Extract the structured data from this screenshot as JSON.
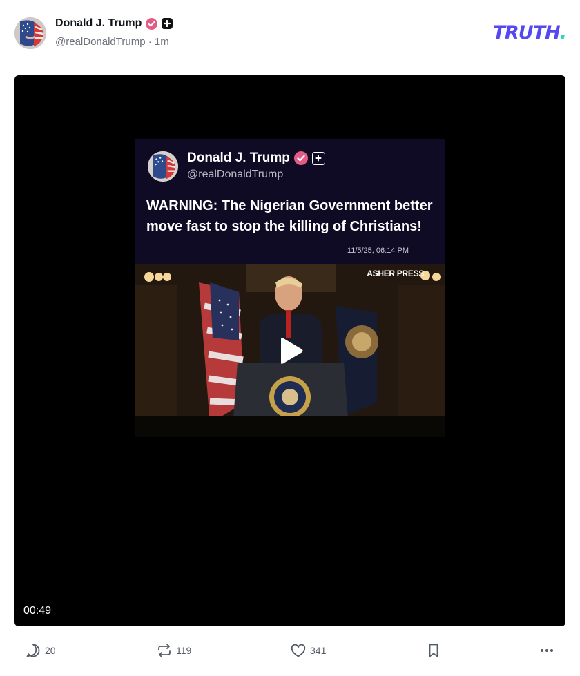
{
  "post": {
    "author": {
      "display_name": "Donald J. Trump",
      "handle": "@realDonaldTrump",
      "separator": "·",
      "timestamp": "1m",
      "avatar_icon": "flag-portrait-avatar",
      "verified_icon": "verified-check-icon",
      "plus_icon": "plus-badge-icon",
      "verified_color": "#e35c86"
    },
    "brand": {
      "logo_text": "TRUTH",
      "logo_dot": ".",
      "logo_color": "#5448ee",
      "dot_color": "#30d5c8"
    },
    "media": {
      "inner_post": {
        "display_name": "Donald J. Trump",
        "handle": "@realDonaldTrump",
        "text": "WARNING: The Nigerian Government better move fast to stop the killing of Christians!",
        "timestamp": "11/5/25, 06:14 PM",
        "background": "#0f0b24"
      },
      "watermark": "ASHER PRESS",
      "duration": "00:49",
      "play_icon": "play-icon"
    },
    "actions": {
      "reply": {
        "icon": "reply-icon",
        "count": "20"
      },
      "repost": {
        "icon": "repost-icon",
        "count": "119"
      },
      "like": {
        "icon": "heart-icon",
        "count": "341"
      },
      "bookmark": {
        "icon": "bookmark-icon"
      },
      "more": {
        "icon": "more-icon"
      }
    }
  }
}
